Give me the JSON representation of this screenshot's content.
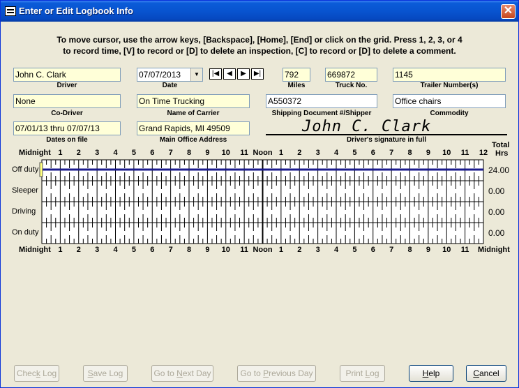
{
  "window": {
    "title": "Enter or Edit Logbook Info",
    "close_glyph": "✕"
  },
  "instructions": {
    "line1": "To move cursor, use the arrow keys, [Backspace], [Home], [End] or click on the grid.  Press 1, 2, 3, or 4",
    "line2": "to record time, [V] to record or [D] to delete an inspection, [C] to record or [D] to delete a comment."
  },
  "fields": {
    "driver": {
      "label": "Driver",
      "value": "John C. Clark"
    },
    "date": {
      "label": "Date",
      "value": "07/07/2013"
    },
    "miles": {
      "label": "Miles",
      "value": "792"
    },
    "truck_no": {
      "label": "Truck No.",
      "value": "669872"
    },
    "trailer": {
      "label": "Trailer Number(s)",
      "value": "1145"
    },
    "co_driver": {
      "label": "Co-Driver",
      "value": "None"
    },
    "carrier": {
      "label": "Name of Carrier",
      "value": "On Time Trucking"
    },
    "shipping": {
      "label": "Shipping Document #/Shipper",
      "value": "A550372"
    },
    "commodity": {
      "label": "Commodity",
      "value": "Office chairs"
    },
    "dates_on_file": {
      "label": "Dates on file",
      "value": "07/01/13 thru 07/07/13"
    },
    "main_office": {
      "label": "Main Office Address",
      "value": "Grand Rapids, MI  49509"
    },
    "signature": {
      "label": "Driver's signature in full",
      "value": "John C. Clark"
    }
  },
  "nav_buttons": {
    "first": "|◀",
    "prev": "◀",
    "next": "▶",
    "last": "▶|"
  },
  "grid": {
    "hour_labels": [
      "Midnight",
      "1",
      "2",
      "3",
      "4",
      "5",
      "6",
      "7",
      "8",
      "9",
      "10",
      "11",
      "Noon",
      "1",
      "2",
      "3",
      "4",
      "5",
      "6",
      "7",
      "8",
      "9",
      "10",
      "11",
      "12"
    ],
    "bottom_hour_labels": [
      "Midnight",
      "1",
      "2",
      "3",
      "4",
      "5",
      "6",
      "7",
      "8",
      "9",
      "10",
      "11",
      "Noon",
      "1",
      "2",
      "3",
      "4",
      "5",
      "6",
      "7",
      "8",
      "9",
      "10",
      "11",
      "Midnight"
    ],
    "total_header_line1": "Total",
    "total_header_line2": "Hrs",
    "rows": [
      {
        "label": "Off duty",
        "total": "24.00"
      },
      {
        "label": "Sleeper",
        "total": "0.00"
      },
      {
        "label": "Driving",
        "total": "0.00"
      },
      {
        "label": "On duty",
        "total": "0.00"
      }
    ],
    "line_color": "#1a1a8c"
  },
  "buttons": {
    "check_log": {
      "pre": "Chec",
      "key": "k",
      "post": " Log"
    },
    "save_log": {
      "pre": "",
      "key": "S",
      "post": "ave Log"
    },
    "next_day": {
      "pre": "Go to ",
      "key": "N",
      "post": "ext Day"
    },
    "prev_day": {
      "pre": "Go to ",
      "key": "P",
      "post": "revious Day"
    },
    "print_log": {
      "pre": "Print ",
      "key": "L",
      "post": "og"
    },
    "help": {
      "pre": "",
      "key": "H",
      "post": "elp"
    },
    "cancel": {
      "pre": "",
      "key": "C",
      "post": "ancel"
    }
  }
}
